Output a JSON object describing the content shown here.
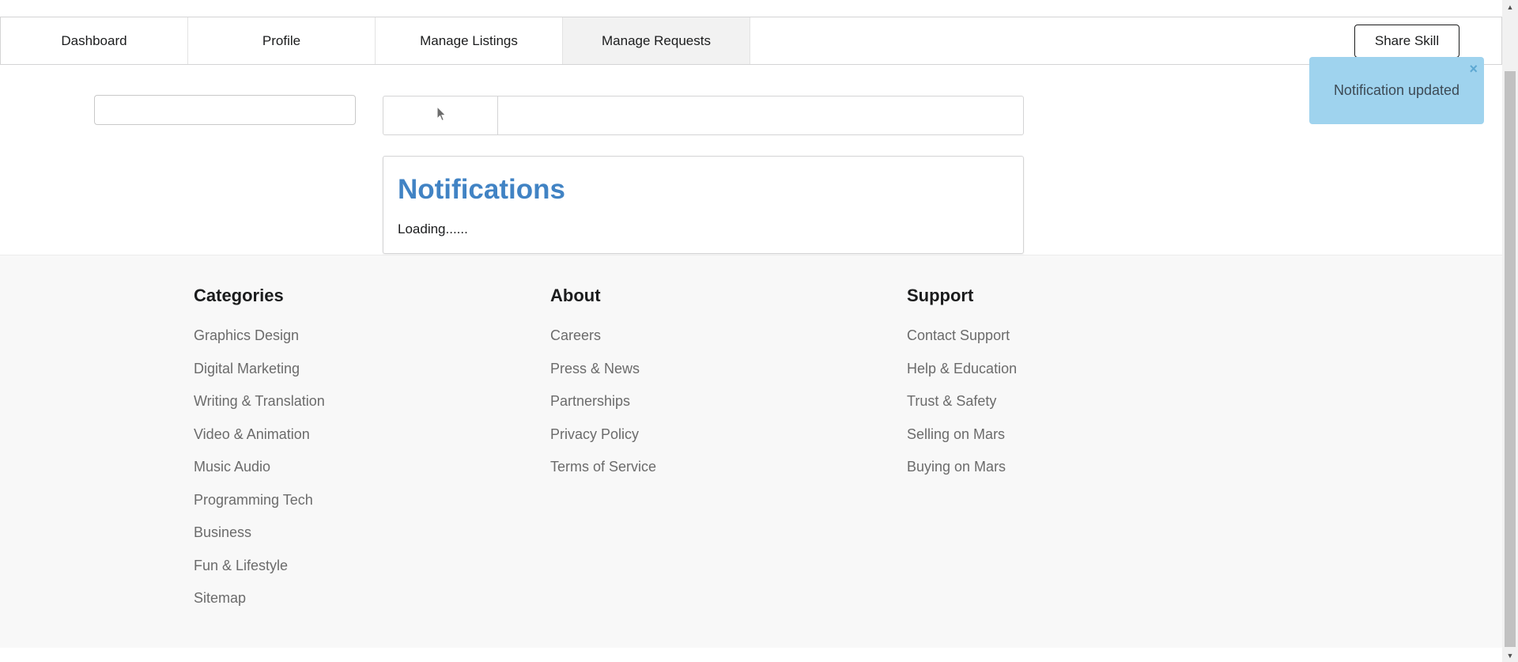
{
  "topmenu": {
    "tabs": [
      {
        "label": "Dashboard"
      },
      {
        "label": "Profile"
      },
      {
        "label": "Manage Listings"
      },
      {
        "label": "Manage Requests",
        "active": true
      }
    ],
    "share_label": "Share Skill"
  },
  "notifications": {
    "title": "Notifications",
    "status": "Loading......"
  },
  "toast": {
    "message": "Notification updated",
    "close_symbol": "×",
    "color": "#9fd3ee"
  },
  "footer": {
    "columns": [
      {
        "heading": "Categories",
        "links": [
          "Graphics Design",
          "Digital Marketing",
          "Writing & Translation",
          "Video & Animation",
          "Music Audio",
          "Programming Tech",
          "Business",
          "Fun & Lifestyle",
          "Sitemap"
        ]
      },
      {
        "heading": "About",
        "links": [
          "Careers",
          "Press & News",
          "Partnerships",
          "Privacy Policy",
          "Terms of Service"
        ]
      },
      {
        "heading": "Support",
        "links": [
          "Contact Support",
          "Help & Education",
          "Trust & Safety",
          "Selling on Mars",
          "Buying on Mars"
        ]
      }
    ]
  },
  "colors": {
    "accent": "#4183c4",
    "toast_bg": "#9fd3ee",
    "footer_bg": "#f8f8f8"
  },
  "icons": {
    "scroll_up": "triangle-up",
    "scroll_down": "triangle-down",
    "cursor": "mouse-pointer"
  }
}
